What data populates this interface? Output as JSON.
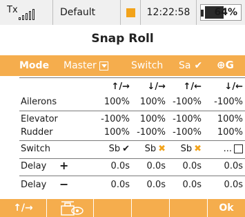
{
  "status": {
    "tx_label": "Tx",
    "signal_icon": "signal-bars-icon",
    "model_name": "Default",
    "clock": "12:22:58",
    "battery_percent": "64%",
    "battery_level": 0.64,
    "warning_color": "#f2a31b"
  },
  "title": "Snap Roll",
  "mode": {
    "label": "Mode",
    "value": "Master",
    "switch_label": "Switch",
    "switch_value": "Sa",
    "switch_state": "✔",
    "global_label": "G"
  },
  "table": {
    "headers": [
      "↑/→",
      "↓/→",
      "↑/←",
      "↓/←"
    ],
    "rows": [
      {
        "label": "Ailerons",
        "values": [
          "100%",
          "100%",
          "-100%",
          "-100%"
        ]
      },
      {
        "label": "Elevator",
        "values": [
          "-100%",
          "100%",
          "-100%",
          "100%"
        ]
      },
      {
        "label": "Rudder",
        "values": [
          "100%",
          "-100%",
          "-100%",
          "100%"
        ]
      }
    ],
    "switch_row": {
      "label": "Switch",
      "values": [
        {
          "text": "Sb",
          "state": "✔"
        },
        {
          "text": "Sb",
          "state": "✖"
        },
        {
          "text": "Sb",
          "state": "✖"
        },
        {
          "text": "...",
          "state": ""
        }
      ]
    },
    "delay_rows": [
      {
        "label": "Delay",
        "sign": "+",
        "values": [
          "0.0s",
          "0.0s",
          "0.0s",
          "0.0s"
        ]
      },
      {
        "label": "Delay",
        "sign": "−",
        "values": [
          "0.0s",
          "0.0s",
          "0.0s",
          "0.0s"
        ]
      }
    ]
  },
  "menu": {
    "f1": "↑/→",
    "f2_icon": "servo-eye-icon",
    "f6": "Ok"
  },
  "colors": {
    "accent": "#f5ad4d",
    "warning": "#f2a31b"
  }
}
